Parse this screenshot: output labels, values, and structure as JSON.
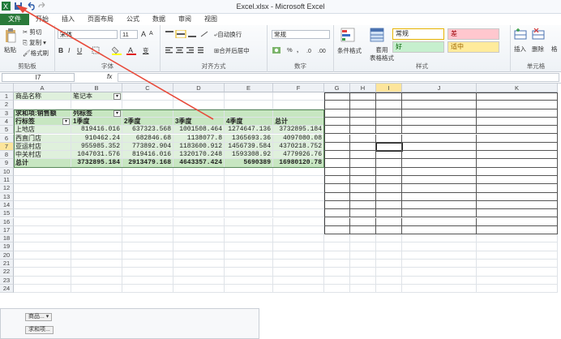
{
  "window": {
    "title": "Excel.xlsx - Microsoft Excel"
  },
  "tabs": [
    "文件",
    "开始",
    "插入",
    "页面布局",
    "公式",
    "数据",
    "审阅",
    "视图"
  ],
  "ribbon": {
    "clipboard": {
      "paste": "粘贴",
      "cut": "剪切",
      "copy": "复制 ▾",
      "format_painter": "格式刷",
      "label": "剪贴板"
    },
    "font": {
      "name": "宋体",
      "size": "11",
      "grow": "A",
      "shrink": "A",
      "bold": "B",
      "italic": "I",
      "underline": "U",
      "wen": "变",
      "label": "字体"
    },
    "alignment": {
      "wrap": "自动换行",
      "merge": "合并后居中",
      "label": "对齐方式"
    },
    "number": {
      "format": "常规",
      "percent": "%",
      "comma": ",",
      "label": "数字"
    },
    "styles": {
      "conditional": "条件格式",
      "table": "套用\n表格格式",
      "normal": "常规",
      "bad": "差",
      "good": "好",
      "neutral": "适中",
      "label": "样式"
    },
    "cells": {
      "insert": "插入",
      "delete": "删除",
      "format": "格",
      "label": "单元格"
    }
  },
  "formula_bar": {
    "name_box": "I7",
    "fx": "fx",
    "value": ""
  },
  "columns": [
    "A",
    "B",
    "C",
    "D",
    "E",
    "F",
    "G",
    "H",
    "I",
    "J",
    "K"
  ],
  "rows": [
    "1",
    "2",
    "3",
    "4",
    "5",
    "6",
    "7",
    "8",
    "9",
    "10",
    "11",
    "12",
    "13",
    "14",
    "15",
    "16",
    "17",
    "18",
    "19",
    "20",
    "21",
    "22",
    "23",
    "24"
  ],
  "pivot": {
    "filter_label": "商品名称",
    "filter_value": "笔记本",
    "sum_label": "求和项:销售额",
    "col_label": "列标签",
    "row_label": "行标签",
    "headers": [
      "1季度",
      "2季度",
      "3季度",
      "4季度",
      "总计"
    ],
    "rows": [
      {
        "name": "上地店",
        "values": [
          "819416.016",
          "637323.568",
          "1001508.464",
          "1274647.136",
          "3732895.184"
        ]
      },
      {
        "name": "西直门店",
        "values": [
          "910462.24",
          "682846.68",
          "1138077.8",
          "1365693.36",
          "4097080.08"
        ]
      },
      {
        "name": "亚运村店",
        "values": [
          "955985.352",
          "773892.904",
          "1183600.912",
          "1456739.584",
          "4370218.752"
        ]
      },
      {
        "name": "中关村店",
        "values": [
          "1047031.576",
          "819416.016",
          "1320170.248",
          "1593308.92",
          "4779926.76"
        ]
      }
    ],
    "total": {
      "name": "总计",
      "values": [
        "3732895.184",
        "2913479.168",
        "4643357.424",
        "5690389",
        "16980120.78"
      ]
    }
  },
  "field_buttons": {
    "product": "商品...",
    "sum": "求和项..."
  },
  "colors": {
    "file_tab": "#2a7a3a",
    "pivot_fill": "#dff0dc",
    "pivot_header": "#c7e6c1",
    "arrow": "#e84a3a"
  }
}
